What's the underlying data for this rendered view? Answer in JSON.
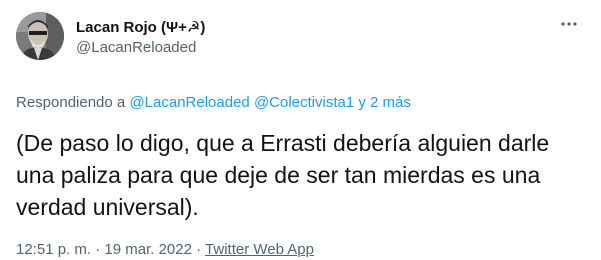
{
  "user": {
    "display_name": "Lacan Rojo (Ψ+☭)",
    "handle": "@LacanReloaded"
  },
  "icons": {
    "more": "more-horizontal-icon",
    "avatar": "profile-photo"
  },
  "reply": {
    "prefix": "Respondiendo a",
    "mention_1": "@LacanReloaded",
    "mention_2": "@Colectivista1",
    "connector": "y",
    "others": "2 más"
  },
  "tweet": {
    "text": "(De paso lo digo, que a Errasti debería alguien darle una paliza para que deje de ser tan mierdas es una verdad universal)."
  },
  "meta": {
    "time": "12:51 p. m.",
    "separator_1": "·",
    "date": "19 mar. 2022",
    "separator_2": "·",
    "source": "Twitter Web App"
  },
  "colors": {
    "link": "#1d9bf0",
    "secondary_text": "#536471",
    "primary_text": "#0f1419"
  }
}
